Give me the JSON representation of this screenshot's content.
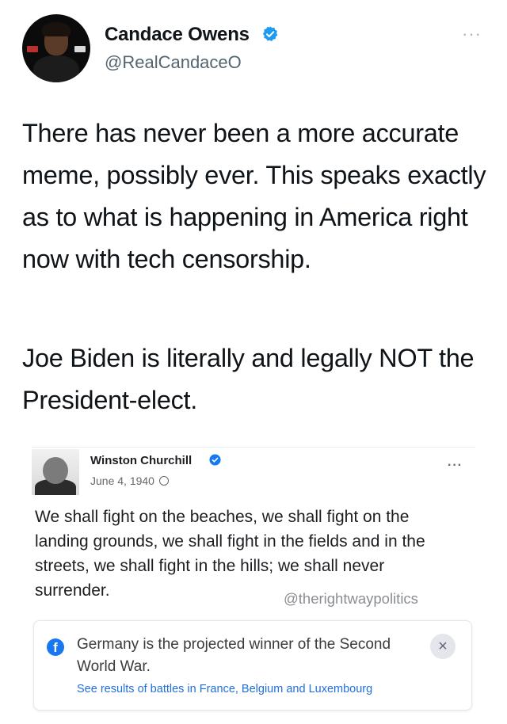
{
  "tweet": {
    "author_name": "Candace Owens",
    "handle": "@RealCandaceO",
    "more_label": "···",
    "paragraph_1": "There has never been a more accurate meme, possibly ever. This speaks exactly as to what is happening in America right now with tech censorship.",
    "paragraph_2": "Joe Biden is literally and legally NOT the President-elect."
  },
  "embedded_post": {
    "author_name": "Winston Churchill",
    "date": "June 4, 1940",
    "more_label": "···",
    "text": "We shall fight on the beaches, we shall fight on the landing grounds, we shall fight in the fields and in the streets, we shall fight in the hills; we shall never surrender.",
    "watermark": "@therightwaypolitics",
    "notice": {
      "title": "Germany is the projected winner of the Second World War.",
      "link": "See results of battles in France, Belgium and Luxembourg",
      "close_label": "×",
      "icon_label": "f"
    }
  },
  "icons": {
    "verified": "verified-badge-icon",
    "globe": "globe-icon",
    "facebook": "facebook-icon",
    "close": "close-icon"
  },
  "colors": {
    "twitter_blue": "#1d9bf0",
    "facebook_blue": "#1877f2",
    "link_blue": "#216fdb"
  }
}
